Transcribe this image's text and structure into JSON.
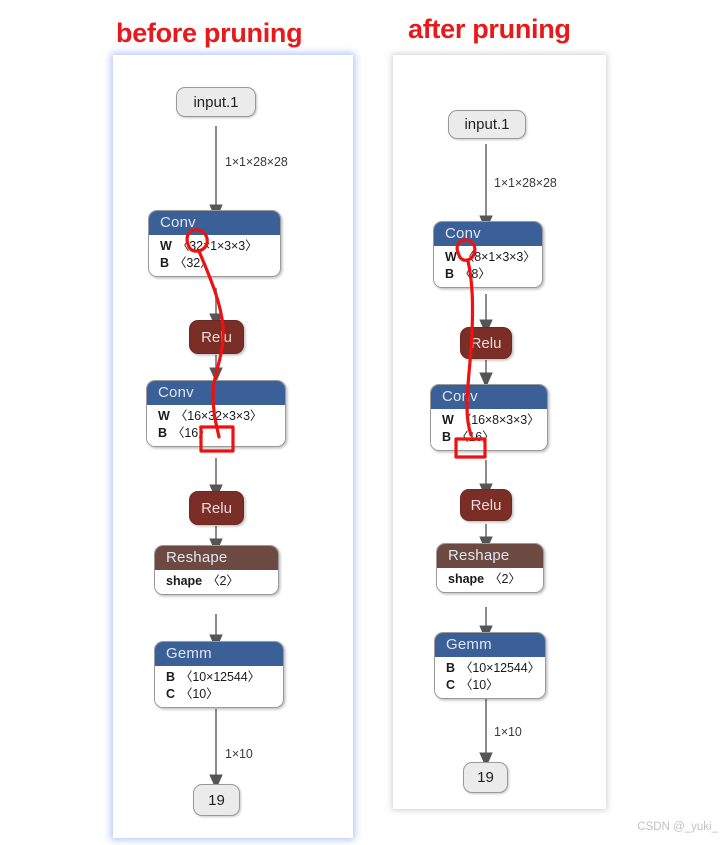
{
  "titles": {
    "before": "before pruning",
    "after": "after pruning"
  },
  "watermark": "CSDN @_yuki_",
  "colors": {
    "title_red": "#e8191c",
    "conv_header_blue": "#3b5f97",
    "reshape_header_brown": "#6d4a41",
    "relu_maroon": "#7b2e26",
    "io_node_gray": "#ebebeb",
    "annotation_red": "#ee1111",
    "panel_glow_blue": "#7896eb"
  },
  "before": {
    "input": {
      "label": "input.1"
    },
    "edge_input_conv1": "1×1×28×28",
    "conv1": {
      "op": "Conv",
      "w_key": "W",
      "w_val": "〈32×1×3×3〉",
      "b_key": "B",
      "b_val": "〈32〉"
    },
    "relu1": {
      "op": "Relu"
    },
    "conv2": {
      "op": "Conv",
      "w_key": "W",
      "w_val": "〈16×32×3×3〉",
      "b_key": "B",
      "b_val": "〈16〉"
    },
    "relu2": {
      "op": "Relu"
    },
    "reshape": {
      "op": "Reshape",
      "shape_key": "shape",
      "shape_val": "〈2〉"
    },
    "gemm": {
      "op": "Gemm",
      "b_key": "B",
      "b_val": "〈10×12544〉",
      "c_key": "C",
      "c_val": "〈10〉"
    },
    "edge_gemm_output": "1×10",
    "output": {
      "label": "19"
    }
  },
  "after": {
    "input": {
      "label": "input.1"
    },
    "edge_input_conv1": "1×1×28×28",
    "conv1": {
      "op": "Conv",
      "w_key": "W",
      "w_val": "〈8×1×3×3〉",
      "b_key": "B",
      "b_val": "〈8〉"
    },
    "relu1": {
      "op": "Relu"
    },
    "conv2": {
      "op": "Conv",
      "w_key": "W",
      "w_val": "〈16×8×3×3〉",
      "b_key": "B",
      "b_val": "〈16〉"
    },
    "relu2": {
      "op": "Relu"
    },
    "reshape": {
      "op": "Reshape",
      "shape_key": "shape",
      "shape_val": "〈2〉"
    },
    "gemm": {
      "op": "Gemm",
      "b_key": "B",
      "b_val": "〈10×12544〉",
      "c_key": "C",
      "c_val": "〈10〉"
    },
    "edge_gemm_output": "1×10",
    "output": {
      "label": "19"
    }
  }
}
